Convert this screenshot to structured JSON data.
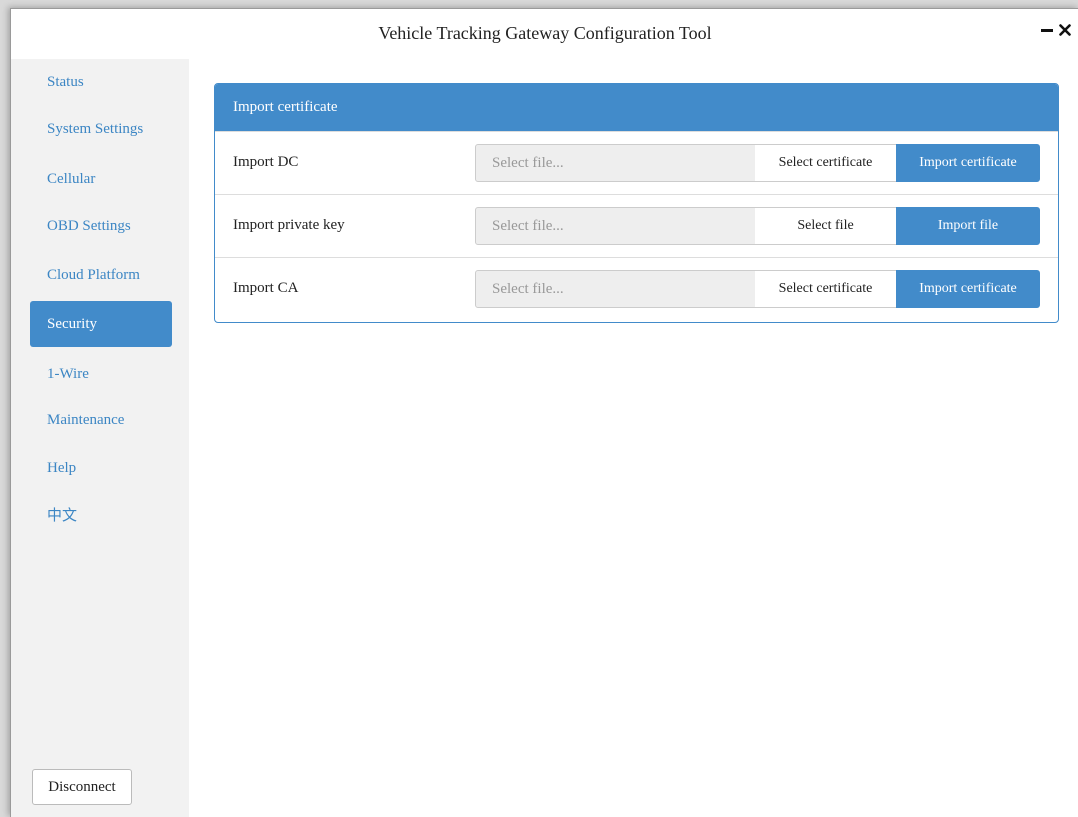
{
  "window": {
    "title": "Vehicle Tracking Gateway Configuration Tool",
    "minimize_icon": "minus-icon",
    "close_icon": "close-icon"
  },
  "sidebar": {
    "items": [
      {
        "label": "Status",
        "active": false
      },
      {
        "label": "System Settings",
        "active": false
      },
      {
        "label": "Cellular",
        "active": false
      },
      {
        "label": "OBD Settings",
        "active": false
      },
      {
        "label": "Cloud Platform",
        "active": false
      },
      {
        "label": "Security",
        "active": true
      },
      {
        "label": "1-Wire",
        "active": false
      },
      {
        "label": "Maintenance",
        "active": false
      },
      {
        "label": "Help",
        "active": false
      },
      {
        "label": "中文",
        "active": false
      }
    ],
    "disconnect_label": "Disconnect"
  },
  "panel": {
    "heading": "Import certificate",
    "rows": [
      {
        "label": "Import DC",
        "placeholder": "Select file...",
        "select_label": "Select certificate",
        "import_label": "Import certificate"
      },
      {
        "label": "Import private key",
        "placeholder": "Select file...",
        "select_label": "Select file",
        "import_label": "Import file"
      },
      {
        "label": "Import CA",
        "placeholder": "Select file...",
        "select_label": "Select certificate",
        "import_label": "Import certificate"
      }
    ]
  },
  "colors": {
    "accent": "#428bca",
    "link": "#3c86c4",
    "sidebar_bg": "#f2f2f2"
  }
}
